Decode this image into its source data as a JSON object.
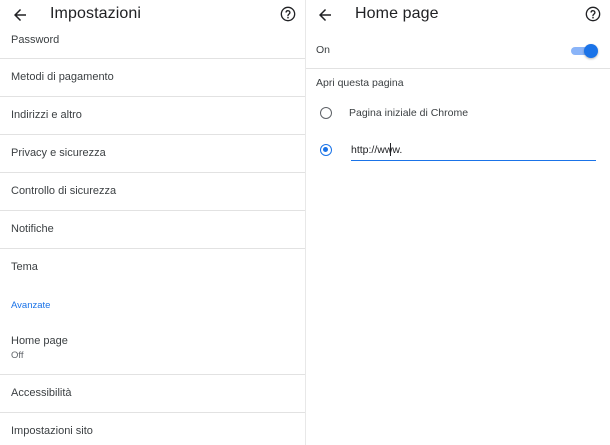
{
  "settings": {
    "title": "Impostazioni",
    "items": [
      {
        "label": "Password"
      },
      {
        "label": "Metodi di pagamento"
      },
      {
        "label": "Indirizzi e altro"
      },
      {
        "label": "Privacy e sicurezza"
      },
      {
        "label": "Controllo di sicurezza"
      },
      {
        "label": "Notifiche"
      },
      {
        "label": "Tema"
      }
    ],
    "advanced_section": "Avanzate",
    "advanced_items": [
      {
        "label": "Home page",
        "sub": "Off"
      },
      {
        "label": "Accessibilità"
      },
      {
        "label": "Impostazioni sito"
      }
    ]
  },
  "homepage": {
    "title": "Home page",
    "toggle_label": "On",
    "toggle_on": true,
    "group_label": "Apri questa pagina",
    "options": [
      {
        "label": "Pagina iniziale di Chrome",
        "selected": false
      },
      {
        "label": "",
        "selected": true
      }
    ],
    "url_value": "http://www."
  },
  "colors": {
    "accent": "#1a73e8",
    "track": "#8ab4f8",
    "text": "#202124",
    "divider": "#e2e2e2"
  },
  "icons": {
    "back": "arrow-back-icon",
    "help": "help-circle-icon"
  }
}
